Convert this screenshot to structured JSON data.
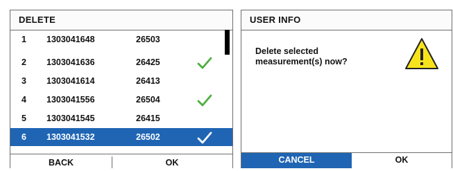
{
  "delete_panel": {
    "title": "DELETE",
    "rows": [
      {
        "index": "1",
        "id": "1303041648",
        "value": "26503",
        "checked": false,
        "selected": false
      },
      {
        "index": "2",
        "id": "1303041636",
        "value": "26425",
        "checked": true,
        "selected": false
      },
      {
        "index": "3",
        "id": "1303041614",
        "value": "26413",
        "checked": false,
        "selected": false
      },
      {
        "index": "4",
        "id": "1303041556",
        "value": "26504",
        "checked": true,
        "selected": false
      },
      {
        "index": "5",
        "id": "1303041545",
        "value": "26415",
        "checked": false,
        "selected": false
      },
      {
        "index": "6",
        "id": "1303041532",
        "value": "26502",
        "checked": true,
        "selected": true
      }
    ],
    "back_label": "BACK",
    "ok_label": "OK"
  },
  "user_info_panel": {
    "title": "USER INFO",
    "message_line1": "Delete selected",
    "message_line2": "measurement(s) now?",
    "cancel_label": "CANCEL",
    "ok_label": "OK",
    "warning_icon": "warning-triangle-icon"
  },
  "colors": {
    "accent": "#1f65b4",
    "check_green": "#4caf3c",
    "warning_yellow": "#f7e31c"
  }
}
